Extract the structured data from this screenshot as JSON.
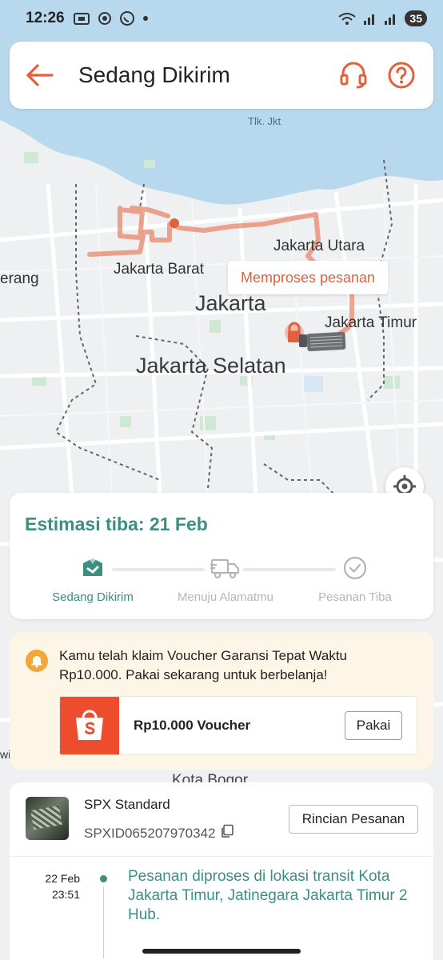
{
  "status_bar": {
    "time": "12:26",
    "battery": "35"
  },
  "header": {
    "title": "Sedang Dikirim"
  },
  "map": {
    "labels": {
      "teluk": "Tlk. Jkt",
      "jakarta_utara": "Jakarta Utara",
      "jakarta_barat": "Jakarta Barat",
      "tangerang": "erang",
      "jakarta": "Jakarta",
      "jakarta_timur": "Jakarta Timur",
      "jakarta_selatan": "Jakarta Selatan",
      "kota_bogor": "Kota Bogor",
      "edge_w": "wi"
    },
    "processing_tag": "Memproses pesanan",
    "route_color": "#e9876b"
  },
  "estimate": {
    "title": "Estimasi tiba: 21 Feb",
    "steps": [
      {
        "label": "Sedang Dikirim",
        "active": true,
        "icon": "box-icon"
      },
      {
        "label": "Menuju Alamatmu",
        "active": false,
        "icon": "truck-icon"
      },
      {
        "label": "Pesanan Tiba",
        "active": false,
        "icon": "check-circle-icon"
      }
    ],
    "accent": "#3b8f82"
  },
  "voucher": {
    "message": "Kamu telah klaim Voucher Garansi Tepat Waktu Rp10.000. Pakai sekarang untuk berbelanja!",
    "ticket_label": "Rp10.000 Voucher",
    "button": "Pakai",
    "brand_color": "#ee4d2d"
  },
  "shipment": {
    "courier": "SPX Standard",
    "tracking_number": "SPXID065207970342",
    "details_button": "Rincian Pesanan",
    "timeline": [
      {
        "date": "22 Feb",
        "time": "23:51",
        "text": "Pesanan diproses di lokasi transit Kota Jakarta Timur, Jatinegara Jakarta Timur 2 Hub."
      }
    ]
  }
}
